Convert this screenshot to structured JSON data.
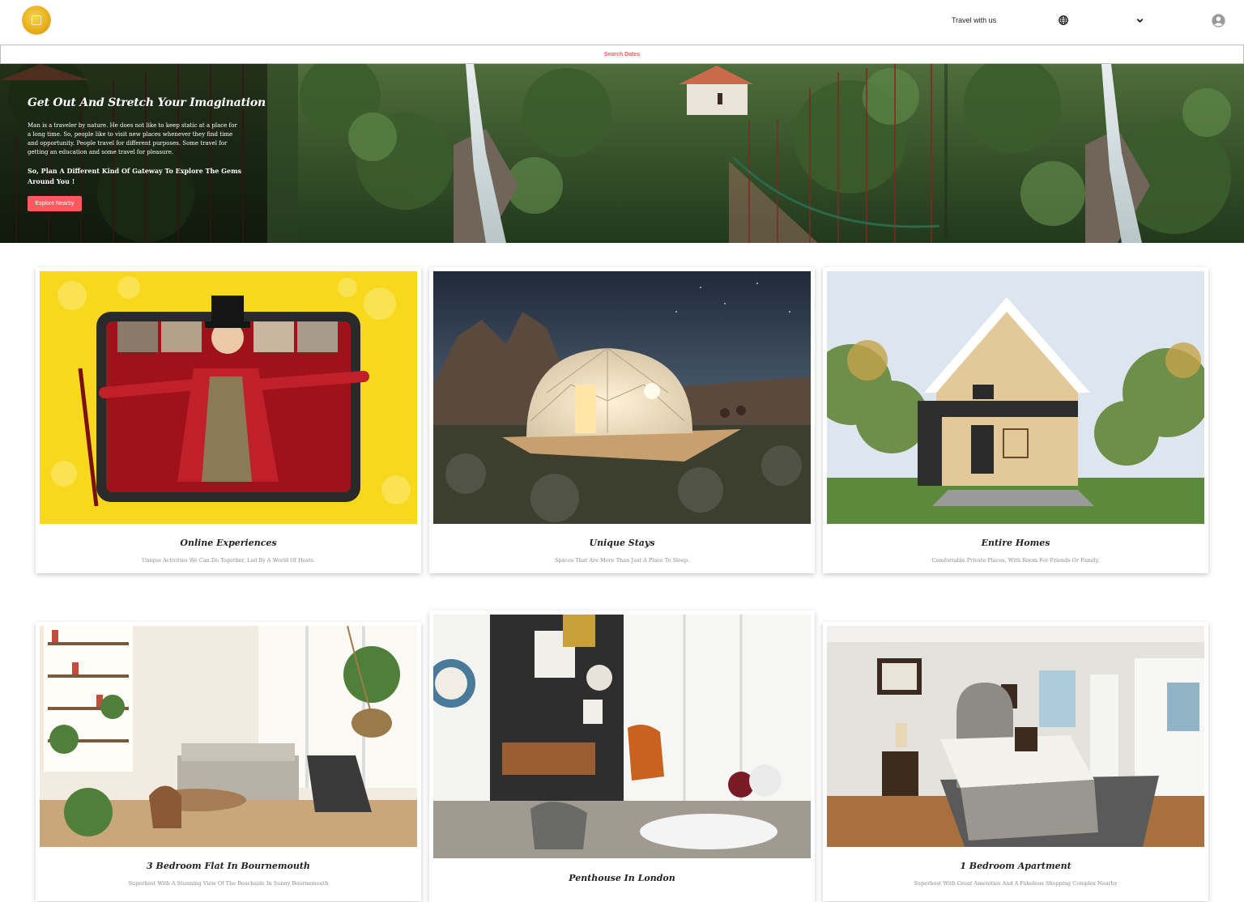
{
  "header": {
    "nav_link": "Travel with us",
    "icons": [
      "logo",
      "globe-icon",
      "chevron-down-icon",
      "user-icon"
    ]
  },
  "search": {
    "label": "Search Dates"
  },
  "hero": {
    "title": "Get Out And Stretch Your Imagination",
    "text": "Man is a traveler by nature. He does not like to keep static at a place for a long time. So, people like to visit new places whenever they find time and opportunity. People travel for different purposes. Some travel for getting an education and some travel for pleasure.",
    "subtitle": "So, Plan A Different Kind Of Gateway To Explore The Gems Around You !",
    "button": "Explore Nearby"
  },
  "cards_row1": [
    {
      "title": "Online Experiences",
      "desc": "Unique Activities We Can Do Together, Led By A World Of Hosts."
    },
    {
      "title": "Unique Stays",
      "desc": "Spaces That Are More Than Just A Place To Sleep."
    },
    {
      "title": "Entire Homes",
      "desc": "Comfortable Private Places, With Room For Friends Or Family."
    }
  ],
  "cards_row2": [
    {
      "title": "3 Bedroom Flat In Bournemouth",
      "desc": "Superhost With A Stunning View Of The Beachside In Sunny Bournemouth"
    },
    {
      "title": "Penthouse In London",
      "desc": ""
    },
    {
      "title": "1 Bedroom Apartment",
      "desc": "Superhost With Great Amenities And A Fabolous Shopping Complex Nearby"
    }
  ],
  "colors": {
    "accent": "#ff5a5f",
    "muted_text": "#8a8a8a"
  }
}
